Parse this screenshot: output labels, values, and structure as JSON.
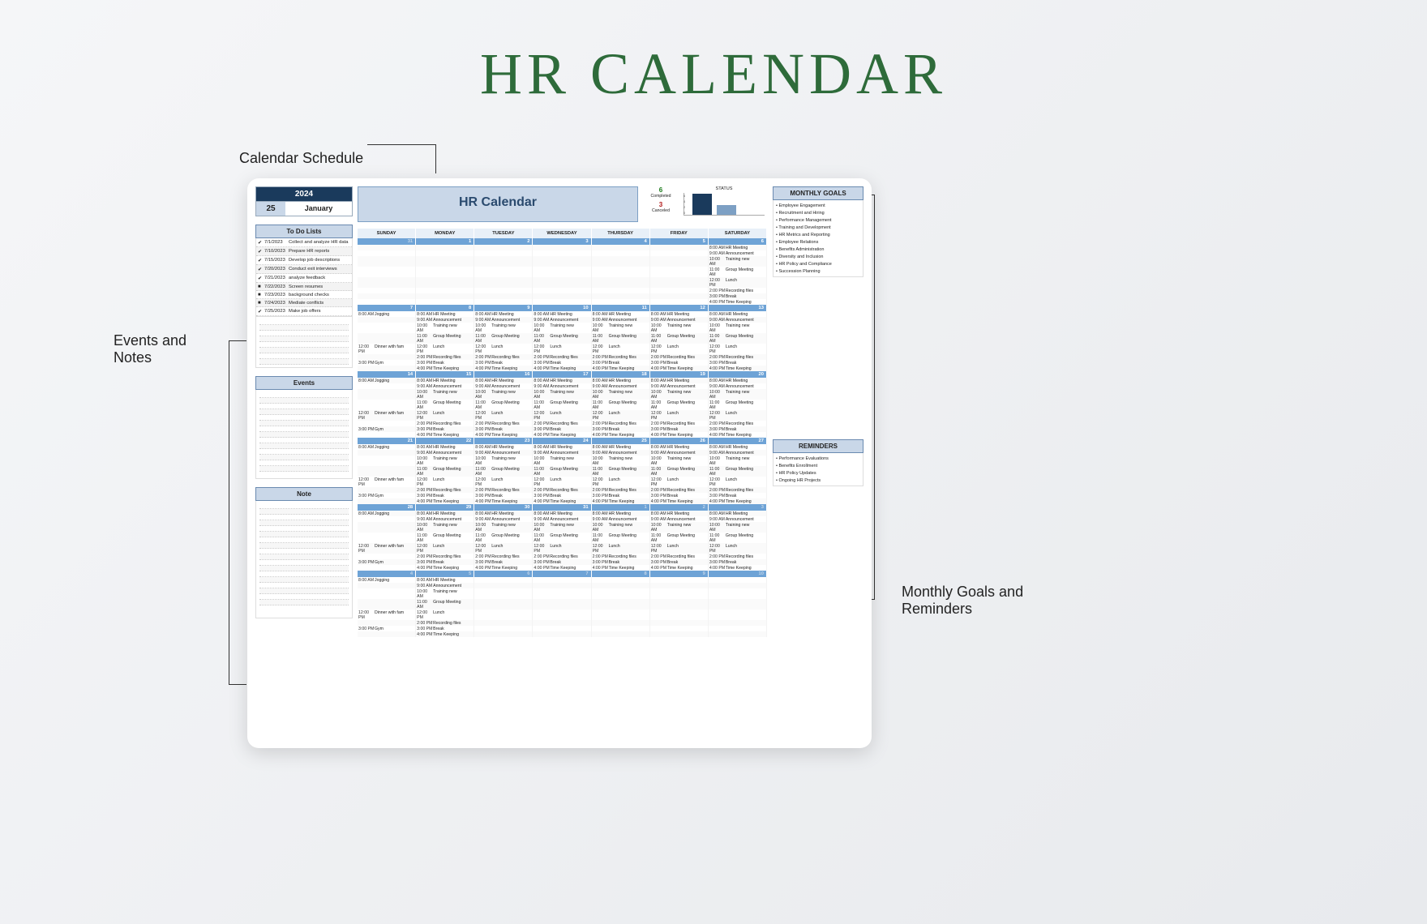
{
  "page_title": "HR CALENDAR",
  "annotations": {
    "top": "Calendar Schedule",
    "left": "Events and Notes",
    "right": "Monthly Goals and Reminders"
  },
  "template": {
    "year": "2024",
    "day": "25",
    "month": "January",
    "calendar_title": "HR Calendar",
    "status": {
      "title": "STATUS",
      "completed_val": "6",
      "completed_lbl": "Completed",
      "canceled_val": "3",
      "canceled_lbl": "Canceled",
      "axis": [
        "6",
        "4",
        "2",
        "0"
      ],
      "bars": [
        26,
        12
      ]
    },
    "sections": {
      "todo": "To Do Lists",
      "events": "Events",
      "note": "Note",
      "goals": "MONTHLY GOALS",
      "reminders": "REMINDERS"
    },
    "todo_items": [
      {
        "done": true,
        "date": "7/1/2023",
        "name": "Collect and analyze HR data"
      },
      {
        "done": true,
        "date": "7/10/2023",
        "name": "Prepare HR reports"
      },
      {
        "done": true,
        "date": "7/15/2023",
        "name": "Develop job descriptions"
      },
      {
        "done": true,
        "date": "7/20/2023",
        "name": "Conduct exit interviews"
      },
      {
        "done": true,
        "date": "7/21/2023",
        "name": "analyze feedback"
      },
      {
        "done": false,
        "date": "7/22/2023",
        "name": "Screen resumes"
      },
      {
        "done": false,
        "date": "7/23/2023",
        "name": "background checks"
      },
      {
        "done": false,
        "date": "7/24/2023",
        "name": "Mediate conflicts"
      },
      {
        "done": true,
        "date": "7/25/2023",
        "name": "Make job offers"
      }
    ],
    "goals": [
      "• Employee Engagement",
      "• Recruitment and Hiring",
      "• Performance Management",
      "• Training and Development",
      "• HR Metrics and Reporting",
      "• Employee Relations",
      "• Benefits Administration",
      "• Diversity and Inclusion",
      "• HR Policy and Compliance",
      "• Succession Planning"
    ],
    "reminders": [
      "• Performance Evaluations",
      "• Benefits Enrollment",
      "• HR Policy Updates",
      "• Ongoing HR Projects"
    ],
    "dow": [
      "SUNDAY",
      "MONDAY",
      "TUESDAY",
      "WEDNESDAY",
      "THURSDAY",
      "FRIDAY",
      "SATURDAY"
    ],
    "day_schedule": [
      {
        "t": "8:00 AM",
        "e": "HR Meeting"
      },
      {
        "t": "9:00 AM",
        "e": "Announcement"
      },
      {
        "t": "10:00 AM",
        "e": "Training new"
      },
      {
        "t": "11:00 AM",
        "e": "Group Meeting"
      },
      {
        "t": "12:00 PM",
        "e": "Lunch"
      },
      {
        "t": "2:00 PM",
        "e": "Recording files"
      },
      {
        "t": "3:00 PM",
        "e": "Break"
      },
      {
        "t": "4:00 PM",
        "e": "Time Keeping"
      }
    ],
    "sunday_schedule": [
      {
        "t": "8:00 AM",
        "e": "Jogging"
      },
      {
        "t": "",
        "e": ""
      },
      {
        "t": "",
        "e": ""
      },
      {
        "t": "",
        "e": ""
      },
      {
        "t": "12:00 PM",
        "e": "Dinner with fam"
      },
      {
        "t": "",
        "e": ""
      },
      {
        "t": "3:00 PM",
        "e": "Gym"
      },
      {
        "t": "",
        "e": ""
      }
    ],
    "weeks": [
      {
        "dates": [
          "31",
          "1",
          "2",
          "3",
          "4",
          "5",
          "6"
        ],
        "grey": [
          0
        ],
        "fill": [
          6
        ]
      },
      {
        "dates": [
          "7",
          "8",
          "9",
          "10",
          "11",
          "12",
          "13"
        ],
        "grey": [],
        "fill": [
          0,
          1,
          2,
          3,
          4,
          5,
          6
        ]
      },
      {
        "dates": [
          "14",
          "15",
          "16",
          "17",
          "18",
          "19",
          "20"
        ],
        "grey": [],
        "fill": [
          0,
          1,
          2,
          3,
          4,
          5,
          6
        ]
      },
      {
        "dates": [
          "21",
          "22",
          "23",
          "24",
          "25",
          "26",
          "27"
        ],
        "grey": [],
        "fill": [
          0,
          1,
          2,
          3,
          4,
          5,
          6
        ]
      },
      {
        "dates": [
          "28",
          "29",
          "30",
          "31",
          "1",
          "2",
          "3"
        ],
        "grey": [
          4,
          5,
          6
        ],
        "fill": [
          0,
          1,
          2,
          3,
          4,
          5,
          6
        ]
      },
      {
        "dates": [
          "4",
          "5",
          "6",
          "7",
          "8",
          "9",
          "10"
        ],
        "grey": [
          0,
          1,
          2,
          3,
          4,
          5,
          6
        ],
        "fill": [
          0,
          1
        ]
      }
    ]
  }
}
